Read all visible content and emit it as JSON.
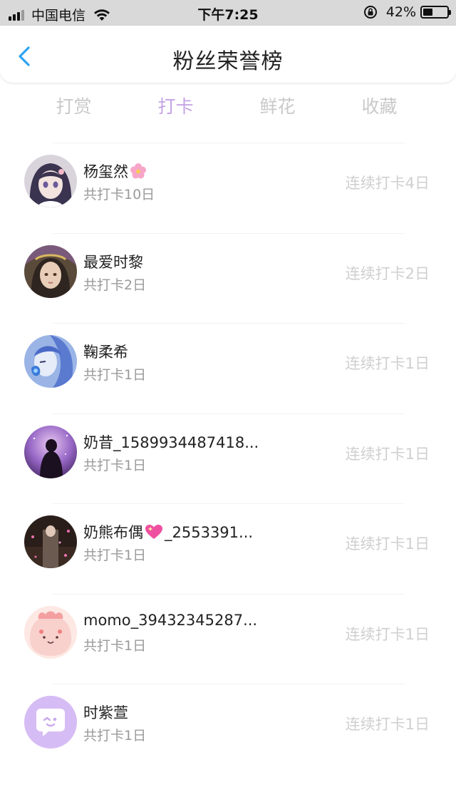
{
  "status_bar": {
    "carrier": "中国电信",
    "time": "下午7:25",
    "battery_percent": "42%",
    "battery_level": 0.42
  },
  "header": {
    "title": "粉丝荣誉榜"
  },
  "tabs": [
    {
      "label": "打赏",
      "active": false
    },
    {
      "label": "打卡",
      "active": true
    },
    {
      "label": "鲜花",
      "active": false
    },
    {
      "label": "收藏",
      "active": false
    }
  ],
  "colors": {
    "accent": "#c5a3e5",
    "back_arrow": "#2ea3f2"
  },
  "fans": [
    {
      "name": "杨玺然",
      "name_emoji": "flower",
      "total": "共打卡10日",
      "streak": "连续打卡4日"
    },
    {
      "name": "最爱时黎",
      "total": "共打卡2日",
      "streak": "连续打卡2日"
    },
    {
      "name": "鞠柔希",
      "total": "共打卡1日",
      "streak": "连续打卡1日"
    },
    {
      "name": "奶昔_1589934487418...",
      "total": "共打卡1日",
      "streak": "连续打卡1日"
    },
    {
      "name_prefix": "奶熊布偶",
      "name_emoji": "heart",
      "name_suffix": "_2553391...",
      "total": "共打卡1日",
      "streak": "连续打卡1日"
    },
    {
      "name": "momo_39432345287...",
      "total": "共打卡1日",
      "streak": "连续打卡1日"
    },
    {
      "name": "时紫萱",
      "total": "共打卡1日",
      "streak": "连续打卡1日"
    }
  ]
}
